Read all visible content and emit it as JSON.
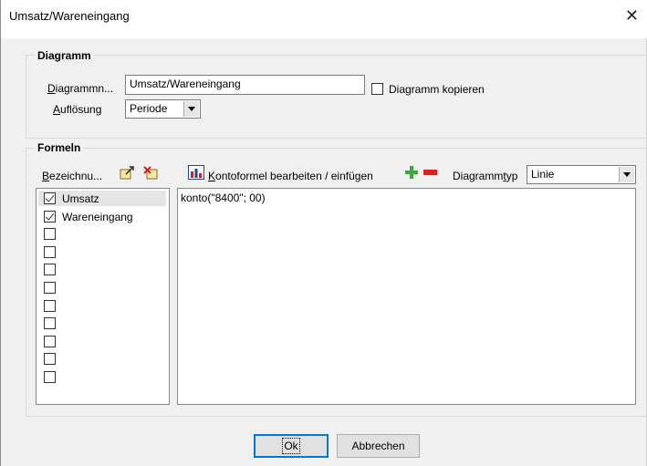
{
  "window": {
    "title": "Umsatz/Wareneingang"
  },
  "diagramm": {
    "group_title": "Diagramm",
    "name_label": "Diagrammn...",
    "name_value": "Umsatz/Wareneingang",
    "copy_label": "Diagramm kopieren",
    "copy_checked": false,
    "aufloesung_label": "Auflösung",
    "aufloesung_value": "Periode"
  },
  "formeln": {
    "group_title": "Formeln",
    "bezeichnung_label": "Bezeichnu...",
    "kontoformel_label": "Kontoformel bearbeiten / einfügen",
    "diagrammtyp_label": "Diagrammtyp",
    "diagrammtyp_value": "Linie",
    "items": [
      {
        "label": "Umsatz",
        "checked": true,
        "selected": true
      },
      {
        "label": "Wareneingang",
        "checked": true,
        "selected": false
      },
      {
        "label": "",
        "checked": false
      },
      {
        "label": "",
        "checked": false
      },
      {
        "label": "",
        "checked": false
      },
      {
        "label": "",
        "checked": false
      },
      {
        "label": "",
        "checked": false
      },
      {
        "label": "",
        "checked": false
      },
      {
        "label": "",
        "checked": false
      },
      {
        "label": "",
        "checked": false
      },
      {
        "label": "",
        "checked": false
      }
    ],
    "formula": "konto(\"8400\"; 00)"
  },
  "buttons": {
    "ok": "Ok",
    "cancel": "Abbrechen"
  },
  "icons": {
    "new_item": "new-item-icon",
    "delete_item": "delete-item-icon",
    "kontoformel": "chart-formula-icon",
    "add": "green-plus-icon",
    "remove": "red-minus-icon"
  },
  "colors": {
    "plus": "#3aa83a",
    "minus": "#e02020",
    "accent": "#0078d7"
  }
}
